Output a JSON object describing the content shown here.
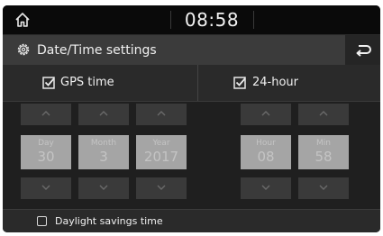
{
  "status_bar": {
    "time": "08:58",
    "home_icon": "home-icon"
  },
  "header": {
    "title": "Date/Time settings",
    "settings_icon": "gear-icon",
    "back_icon": "back-arrow-icon"
  },
  "options": {
    "gps_time": {
      "label": "GPS time",
      "checked": true
    },
    "hour_24": {
      "label": "24-hour",
      "checked": true
    }
  },
  "date_pickers": [
    {
      "label": "Day",
      "value": "30"
    },
    {
      "label": "Month",
      "value": "3"
    },
    {
      "label": "Year",
      "value": "2017"
    }
  ],
  "time_pickers": [
    {
      "label": "Hour",
      "value": "08"
    },
    {
      "label": "Min",
      "value": "58"
    }
  ],
  "daylight_savings": {
    "label": "Daylight savings time",
    "checked": false
  },
  "colors": {
    "background": "#161616",
    "title_bar": "#3b3b3b",
    "disabled_value_box": "#a5a5a5",
    "arrow_button": "#3a3a3a"
  }
}
